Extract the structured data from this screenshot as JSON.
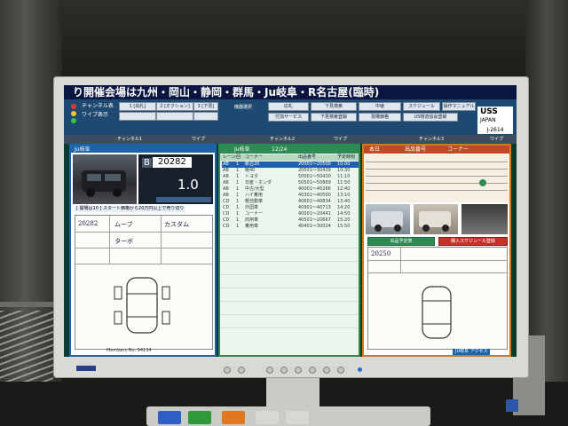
{
  "screen": {
    "ticker": "り開催会場は九州・岡山・静岡・群馬・Ju岐阜・R名古屋(臨時)",
    "brand": {
      "line1": "USS",
      "line2": "JAPAN"
    },
    "lane_id": "J-2614",
    "controls": {
      "channel_label": "チャンネル表",
      "buttons": [
        "1 [出札]",
        "2 [オクション]",
        "3 [下見]",
        "機器選択",
        "応札",
        "下見検索",
        "中継",
        "スケジュール",
        "操作マニュアル",
        "付加サービス",
        "下見検索登録",
        "現場価格",
        "US物流協会登録"
      ],
      "wipe_label": "ワイプ表示"
    },
    "channels": [
      "チャンネル1",
      "ワイプ",
      "チャンネル2",
      "ワイプ",
      "チャンネル3",
      "ワイプ"
    ],
    "left_panel": {
      "venue": "Ju岐阜",
      "lot_prefix": "B",
      "lot_number": "20282",
      "bid_value": "1.0",
      "notice": "[ 開場は10 ] スタート価格から20万円以上で売り切り",
      "memo_no": "Members No. 94134",
      "sheet_hand": [
        "20282",
        "ムーブ",
        "カスタム",
        "ターボ"
      ]
    },
    "middle_panel": {
      "venue": "Ju岐阜",
      "date": "12/24",
      "headers": [
        "レーン",
        "回",
        "コーナー",
        "出品番号",
        "予定時刻"
      ],
      "rows": [
        {
          "lane": "AB",
          "no": "1",
          "corner": "新古20",
          "lot": "20001〜20500",
          "time": "10:00"
        },
        {
          "lane": "AB",
          "no": "1",
          "corner": "軽40",
          "lot": "20501〜30439",
          "time": "10:30"
        },
        {
          "lane": "AB",
          "no": "1",
          "corner": "トヨタ",
          "lot": "50001〜50430",
          "time": "11:10"
        },
        {
          "lane": "AB",
          "no": "1",
          "corner": "日産・ホンダ",
          "lot": "50501〜50869",
          "time": "11:50"
        },
        {
          "lane": "AB",
          "no": "1",
          "corner": "中古/大型",
          "lot": "40001〜40266",
          "time": "12:40"
        },
        {
          "lane": "AB",
          "no": "1",
          "corner": "ハイ乗用",
          "lot": "40301〜40500",
          "time": "13:10"
        },
        {
          "lane": "CD",
          "no": "1",
          "corner": "軽自動車",
          "lot": "40601〜40834",
          "time": "13:40"
        },
        {
          "lane": "CD",
          "no": "1",
          "corner": "外国車",
          "lot": "40901〜40713",
          "time": "14:20"
        },
        {
          "lane": "CD",
          "no": "1",
          "corner": "コーナー",
          "lot": "40001〜20441",
          "time": "14:50"
        },
        {
          "lane": "CD",
          "no": "1",
          "corner": "商用車",
          "lot": "40501〜20667",
          "time": "15:20"
        },
        {
          "lane": "CD",
          "no": "1",
          "corner": "乗用車",
          "lot": "40401〜30024",
          "time": "15:50"
        }
      ]
    },
    "right_panel": {
      "title": "本日",
      "sub1": "出品番号",
      "sub2": "コーナー",
      "lot_number": "20250",
      "btn_schedule": "出品予定表",
      "btn_reserve": "購入スケジュール登録",
      "footer": "JU岐阜 アクセス"
    },
    "colors": {
      "ticker_bg": "#0a1640",
      "control_bg": "#1e4a72",
      "selected_row": "#1f5fb0",
      "button_red": "#c8302a",
      "button_green": "#2d8a52"
    }
  }
}
